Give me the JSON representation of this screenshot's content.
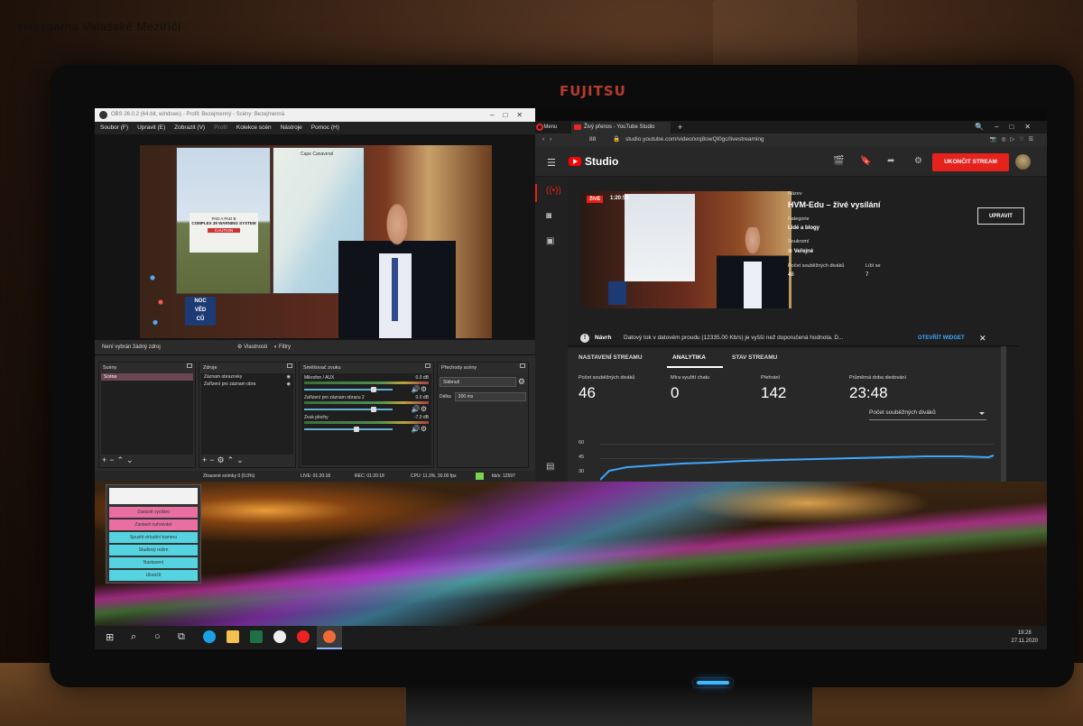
{
  "watermark": "Hvězdárna Valašské Meziříčí",
  "monitor": {
    "brand": "FUJITSU"
  },
  "obs": {
    "title": "OBS 26.0.2 (64-bit, windows) - Profil: Bezejmenný - Scény: Bezejmenná",
    "menu": [
      "Soubor (F)",
      "Upravit (E)",
      "Zobrazit (V)",
      "Profil",
      "Kolekce scén",
      "Nástroje",
      "Pomoc (H)"
    ],
    "preview": {
      "sign_title": "COMPLEX 39 WARNING SYSTEM",
      "sign_pads": "PAD A   PAD B",
      "sign_caution": "CAUTION",
      "map_title": "Cape Canaveral",
      "logo_text": [
        "NOC",
        "VĚD",
        "CŮ"
      ]
    },
    "source_bar": {
      "no_source": "Není vybrán žádný zdroj",
      "properties": "Vlastnosti",
      "filters": "Filtry"
    },
    "docks": {
      "scenes": {
        "title": "Scény",
        "items": [
          "Scéna"
        ]
      },
      "sources": {
        "title": "Zdroje",
        "items": [
          "Záznam obrazovky",
          "Zařízení pro záznam obra"
        ]
      },
      "mixer": {
        "title": "Směšovač zvuku",
        "channels": [
          {
            "name": "Mikrofon / AUX",
            "db": "0.0 dB",
            "level": 0.8
          },
          {
            "name": "Zařízení pro záznam obrazu 2",
            "db": "0.0 dB",
            "level": 0.8
          },
          {
            "name": "Zvuk plochy",
            "db": "-7.0 dB",
            "level": 0.6
          }
        ]
      },
      "transitions": {
        "title": "Přechody scény",
        "selected": "Slábnutí",
        "duration_label": "Délka",
        "duration": "300 ms"
      }
    },
    "status": {
      "dropped": "Ztracené snímky 0 (0.0%)",
      "live": "LIVE: 01:20:18",
      "rec": "REC: 01:20:18",
      "cpu": "CPU: 11.3%, 30.00 fps",
      "kbps": "kb/s: 12597"
    }
  },
  "browser": {
    "menu": "Menu",
    "tab_title": "Živý přenos - YouTube Studio",
    "tab_count": "88",
    "url": "studio.youtube.com/video/xrq8owQl0gc/livestreaming",
    "studio_label": "Studio",
    "end_stream_button": "UKONČIT STREAM",
    "video": {
      "live_badge": "ŽIVĚ",
      "elapsed": "1:20:56"
    },
    "details": {
      "title_label": "Název",
      "title": "HVM-Edu – živé vysílání",
      "category_label": "Kategorie",
      "category": "Lidé a blogy",
      "privacy_label": "Soukromí",
      "privacy": "Veřejné",
      "concurrent_label": "Počet souběžných diváků",
      "concurrent": "48",
      "likes_label": "Líbí se",
      "likes": "7",
      "edit_button": "UPRAVIT"
    },
    "warning": {
      "heading": "Návrh",
      "message": "Datový tok v datovém proudu (12335.00 Kb/s) je vyšší než doporučená hodnota. D...",
      "link": "OTEVŘÍT WIDGET"
    },
    "tabs": [
      "NASTAVENÍ STREAMU",
      "ANALYTIKA",
      "STAV STREAMU"
    ],
    "active_tab": "ANALYTIKA",
    "stats": [
      {
        "label": "Počet souběžných diváků",
        "value": "46"
      },
      {
        "label": "Míra využití chatu",
        "value": "0"
      },
      {
        "label": "Přehrání",
        "value": "142"
      },
      {
        "label": "Průměrná doba sledování",
        "value": "23:48"
      }
    ],
    "metric_dropdown": "Počet souběžných diváků",
    "chart_ticks": [
      "60",
      "45",
      "30"
    ]
  },
  "popup": {
    "items": [
      {
        "label": "Zastavit vysílání",
        "color": "#e86fa0"
      },
      {
        "label": "Zastavit nahrávání",
        "color": "#e86fa0"
      },
      {
        "label": "Spustit virtuální kameru",
        "color": "#55d3e0"
      },
      {
        "label": "Studiový režim",
        "color": "#55d3e0"
      },
      {
        "label": "Nastavení",
        "color": "#55d3e0"
      },
      {
        "label": "Ukončit",
        "color": "#55d3e0"
      }
    ]
  },
  "taskbar": {
    "time": "19:28",
    "date": "27.11.2020"
  }
}
